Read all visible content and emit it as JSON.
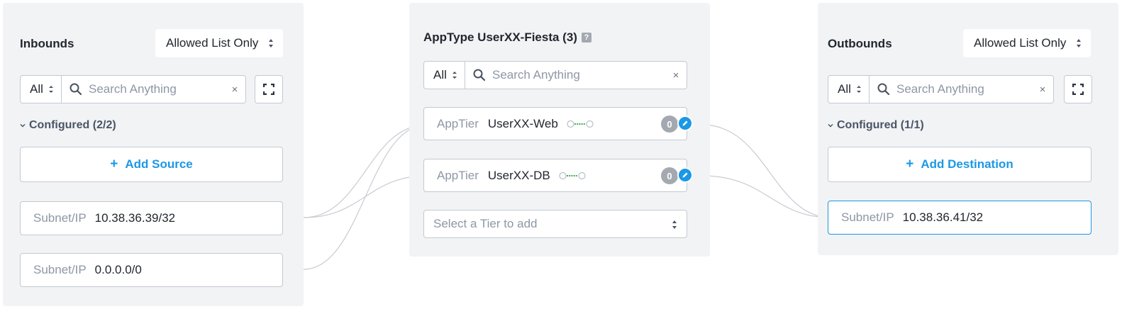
{
  "inbounds": {
    "title": "Inbounds",
    "mode": "Allowed List Only",
    "search": {
      "filter": "All",
      "placeholder": "Search Anything",
      "clear": "×"
    },
    "section": "Configured (2/2)",
    "add_label": "Add Source",
    "entries": [
      {
        "key": "Subnet/IP",
        "value": "10.38.36.39/32"
      },
      {
        "key": "Subnet/IP",
        "value": "0.0.0.0/0"
      }
    ]
  },
  "apptype": {
    "title": "AppType UserXX-Fiesta (3)",
    "help": "?",
    "search": {
      "filter": "All",
      "placeholder": "Search Anything",
      "clear": "×"
    },
    "tiers": [
      {
        "key": "AppTier",
        "value": "UserXX-Web",
        "count": "0"
      },
      {
        "key": "AppTier",
        "value": "UserXX-DB",
        "count": "0"
      }
    ],
    "tier_select_placeholder": "Select a Tier to add"
  },
  "outbounds": {
    "title": "Outbounds",
    "mode": "Allowed List Only",
    "search": {
      "filter": "All",
      "placeholder": "Search Anything",
      "clear": "×"
    },
    "section": "Configured (1/1)",
    "add_label": "Add Destination",
    "entries": [
      {
        "key": "Subnet/IP",
        "value": "10.38.36.41/32"
      }
    ]
  },
  "colors": {
    "accent": "#1b98e6",
    "panel_bg": "#f2f3f5",
    "link_line": "#c9ccd2",
    "badge_gray": "#a4a9b1"
  },
  "icons": [
    "search-icon",
    "clear-icon",
    "fullscreen-icon",
    "chevron-down-icon",
    "plus-icon",
    "edit-icon",
    "tier-link-icon",
    "help-icon",
    "sort-arrows-icon"
  ]
}
